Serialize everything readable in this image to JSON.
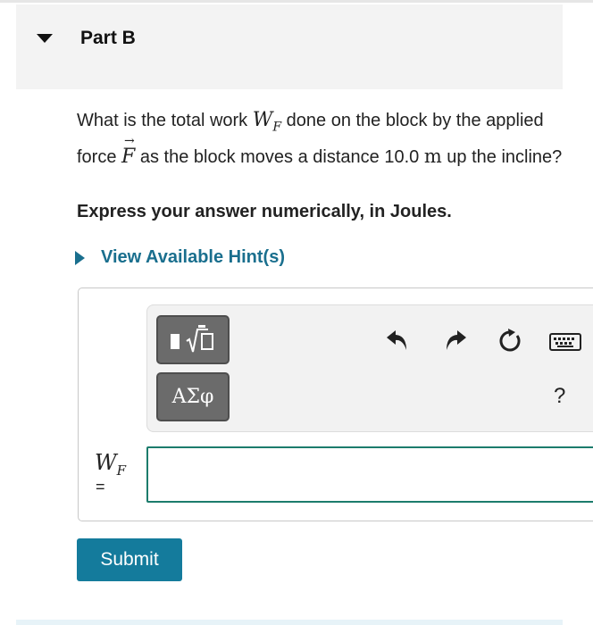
{
  "part": {
    "title": "Part B"
  },
  "question": {
    "text_1": "What is the total work ",
    "work_symbol": "W",
    "work_sub": "F",
    "text_2": " done on the block by the applied force ",
    "force_symbol": "F",
    "text_3": " as the block moves a distance 10.0 ",
    "unit": "m",
    "text_4": " up the incline?"
  },
  "instruction": "Express your answer numerically, in Joules.",
  "hint": {
    "label": "View Available Hint(s)"
  },
  "toolbar": {
    "symbols_label": "ΑΣφ",
    "help_label": "?",
    "icons": [
      "templates-icon",
      "undo-icon",
      "redo-icon",
      "reset-icon",
      "keyboard-icon",
      "help-icon"
    ]
  },
  "answer": {
    "symbol": "W",
    "sub": "F",
    "equals": "=",
    "value": ""
  },
  "submit": {
    "label": "Submit"
  },
  "colors": {
    "accent": "#147b9c",
    "link": "#1a6f8e",
    "input_border": "#1c7c6c"
  }
}
